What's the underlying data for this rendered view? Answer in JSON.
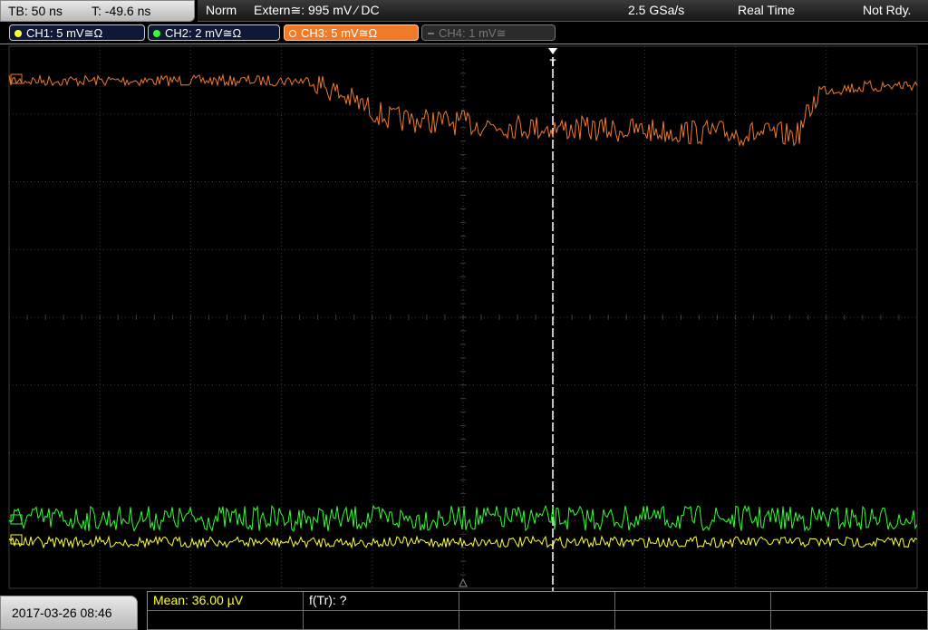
{
  "timebase": {
    "tb": "TB: 50 ns",
    "trig_time": "T: -49.6 ns"
  },
  "status": {
    "mode": "Norm",
    "trigger": "Extern≅: 995 mV ⁄ DC",
    "sample_rate": "2.5 GSa/s",
    "acq_mode": "Real Time",
    "state": "Not Rdy."
  },
  "channels": [
    {
      "label": "CH1: 5 mV≅Ω",
      "color": "#ffff30",
      "active": true
    },
    {
      "label": "CH2: 2 mV≅Ω",
      "color": "#30ff30",
      "active": true
    },
    {
      "label": "CH3: 5 mV≅Ω",
      "color": "#f07a28",
      "active": true,
      "selected": true
    },
    {
      "label": "CH4: 1 mV≅",
      "color": "#777777",
      "active": false
    }
  ],
  "colors": {
    "grid": "#3c3c3c",
    "ch1": "#ffff30",
    "ch2": "#30ff30",
    "ch3": "#f07a28",
    "trigger_marker": "#ffffff"
  },
  "markers": {
    "trigger": "T"
  },
  "bottom": {
    "datetime": "2017-03-26 08:46",
    "measurements": [
      {
        "label": "Mean: 36.00 µV",
        "color": "#ffff30"
      },
      {
        "label": "f(Tr): ?",
        "color": "#ffffff"
      }
    ]
  }
}
